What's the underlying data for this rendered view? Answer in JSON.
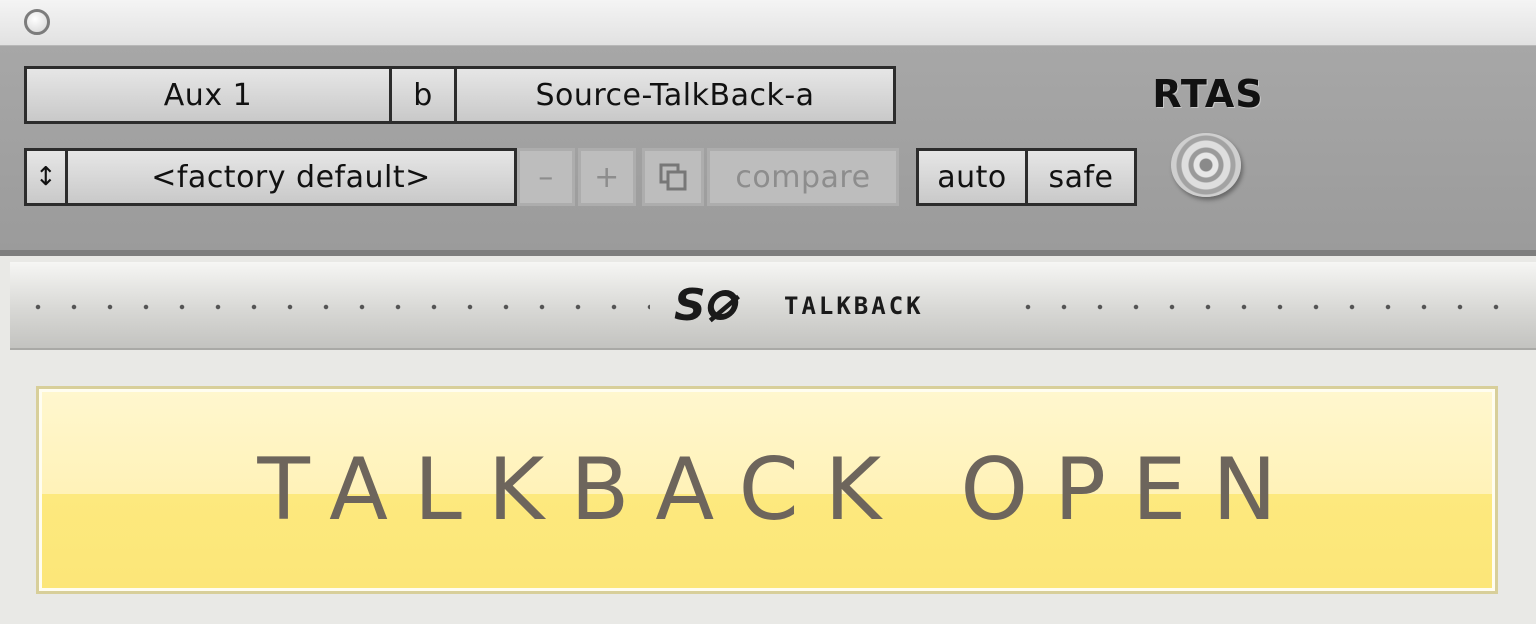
{
  "window": {
    "close_button": "close"
  },
  "header": {
    "track_name": "Aux 1",
    "insert_slot": "b",
    "plugin_name": "Source-TalkBack-a",
    "preset_menu_arrows": "↕",
    "preset_name": "<factory default>",
    "minus_label": "–",
    "plus_label": "+",
    "copy_icon": "copy-icon",
    "compare_label": "compare",
    "auto_label": "auto",
    "safe_label": "safe",
    "format_label": "RTAS"
  },
  "plugin": {
    "brand_logo": "Se",
    "brand_name": "TALKBACK",
    "status_text": "TALKBACK OPEN"
  },
  "colors": {
    "status_fill": "#fde97e",
    "status_text": "#6d655c",
    "header_bg": "#a7a7a7"
  }
}
